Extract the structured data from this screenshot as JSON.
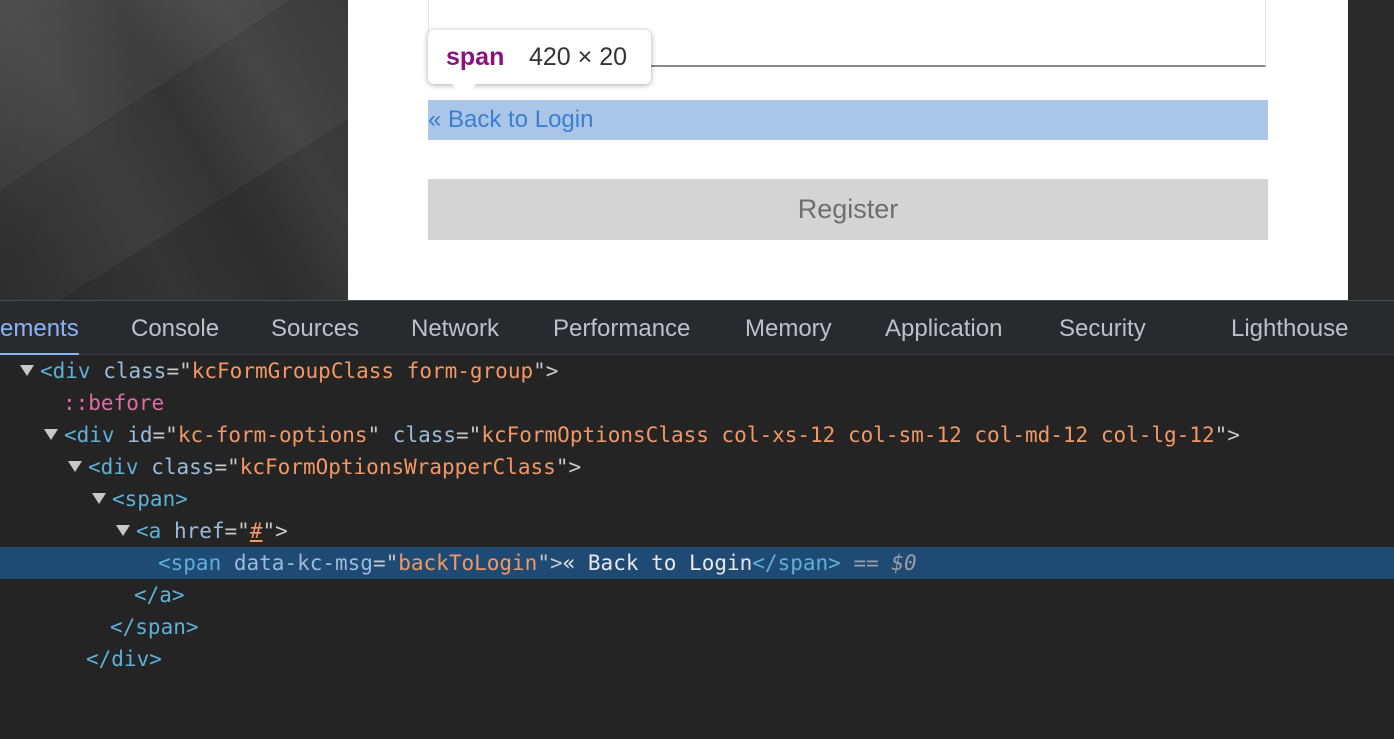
{
  "page": {
    "back_to_login": "« Back to Login",
    "register_label": "Register"
  },
  "tooltip": {
    "tag": "span",
    "size": "420 × 20"
  },
  "devtools": {
    "tabs": [
      {
        "label": "ements",
        "active": true
      },
      {
        "label": "Console"
      },
      {
        "label": "Sources"
      },
      {
        "label": "Network"
      },
      {
        "label": "Performance"
      },
      {
        "label": "Memory"
      },
      {
        "label": "Application"
      },
      {
        "label": "Security"
      },
      {
        "label": "Lighthouse"
      }
    ],
    "tree": {
      "r1": {
        "open": "<div",
        "attr": "class",
        "eq": "=\"",
        "val": "kcFormGroupClass form-group",
        "close": "\">"
      },
      "r2": {
        "pseudo": "::before"
      },
      "r3": {
        "open": "<div",
        "attr1": "id",
        "val1": "kc-form-options",
        "attr2": "class",
        "val2": "kcFormOptionsClass col-xs-12 col-sm-12 col-md-12 col-lg-12",
        "close": "\">"
      },
      "r4": {
        "open": "<div",
        "attr": "class",
        "val": "kcFormOptionsWrapperClass",
        "close": "\">"
      },
      "r5": {
        "tag": "<span>"
      },
      "r6": {
        "open": "<a",
        "attr": "href",
        "val": "#",
        "close": "\">"
      },
      "r7": {
        "open": "<span",
        "attr": "data-kc-msg",
        "val": "backToLogin",
        "text": "« Back to Login",
        "close_tag": "</span>",
        "eq": " == ",
        "dollar": "$0"
      },
      "r8": {
        "tag": "</a>"
      },
      "r9": {
        "tag": "</span>"
      },
      "r10": {
        "tag": "</div>"
      }
    }
  },
  "colors": {
    "tag": "#5db0d7",
    "attribute": "#9bbbdc",
    "value": "#f29766",
    "selected_row": "#1f4a74",
    "active_tab": "#8ab4f8"
  }
}
